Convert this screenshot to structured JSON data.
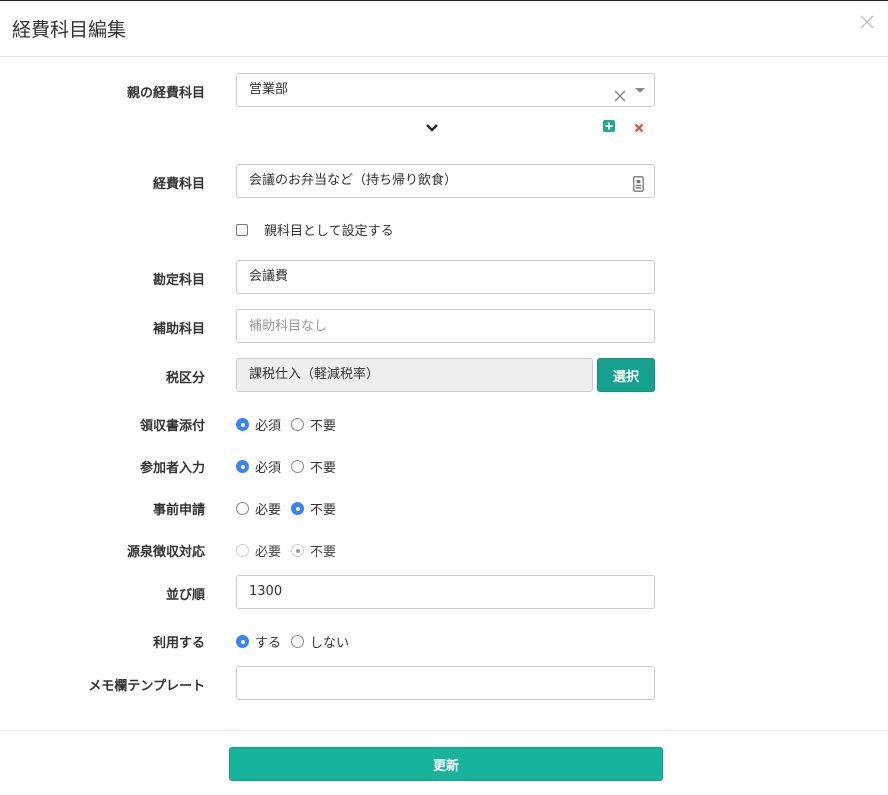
{
  "modal": {
    "title": "経費科目編集",
    "update_label": "更新"
  },
  "parent_category": {
    "label": "親の経費科目",
    "value": "営業部"
  },
  "category": {
    "label": "経費科目",
    "value": "会議のお弁当など（持ち帰り飲食）"
  },
  "set_as_parent": {
    "label": "親科目として設定する",
    "checked": false
  },
  "account": {
    "label": "勘定科目",
    "value": "会議費"
  },
  "sub_account": {
    "label": "補助科目",
    "placeholder": "補助科目なし"
  },
  "tax": {
    "label": "税区分",
    "value": "課税仕入（軽減税率）",
    "select_label": "選択"
  },
  "receipt": {
    "label": "領収書添付",
    "options": [
      "必須",
      "不要"
    ],
    "selected": "必須"
  },
  "participants": {
    "label": "参加者入力",
    "options": [
      "必須",
      "不要"
    ],
    "selected": "必須"
  },
  "pre_approval": {
    "label": "事前申請",
    "options": [
      "必要",
      "不要"
    ],
    "selected": "不要"
  },
  "withholding": {
    "label": "源泉徴収対応",
    "options": [
      "必要",
      "不要"
    ],
    "selected": "不要",
    "disabled": true
  },
  "sort_order": {
    "label": "並び順",
    "value": "1300"
  },
  "usage": {
    "label": "利用する",
    "options": [
      "する",
      "しない"
    ],
    "selected": "する"
  },
  "memo_template": {
    "label": "メモ欄テンプレート",
    "value": ""
  },
  "colors": {
    "accent": "#17b39b",
    "radio_checked": "#3b82f6",
    "add_icon": "#1aae8f",
    "remove_icon": "#e74c3c"
  }
}
